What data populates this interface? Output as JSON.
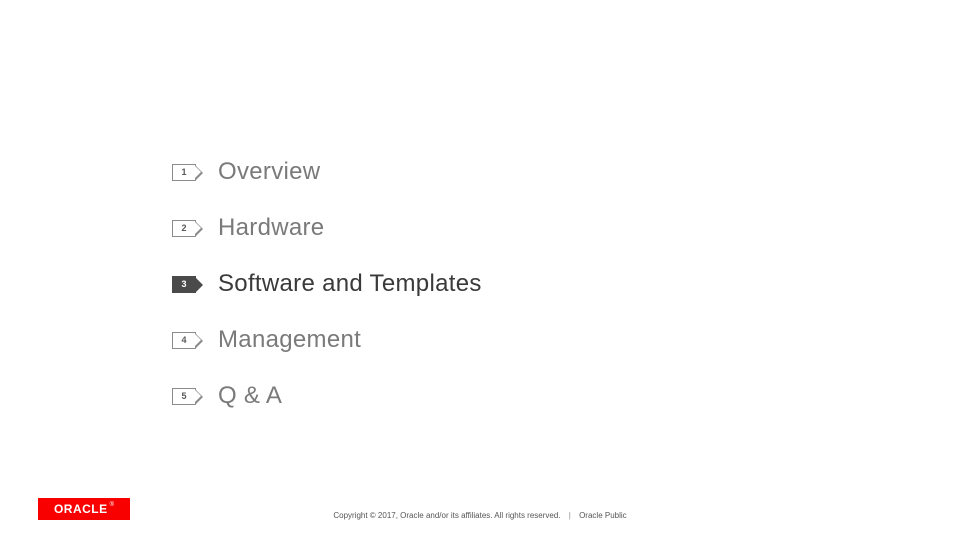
{
  "agenda": {
    "items": [
      {
        "num": "1",
        "label": "Overview",
        "active": false
      },
      {
        "num": "2",
        "label": "Hardware",
        "active": false
      },
      {
        "num": "3",
        "label": "Software and Templates",
        "active": true
      },
      {
        "num": "4",
        "label": "Management",
        "active": false
      },
      {
        "num": "5",
        "label": "Q & A",
        "active": false
      }
    ]
  },
  "logo": {
    "text": "ORACLE",
    "registered": "®"
  },
  "footer": {
    "copyright": "Copyright © 2017, Oracle and/or its affiliates. All rights reserved.",
    "separator": "|",
    "classification": "Oracle Public"
  }
}
